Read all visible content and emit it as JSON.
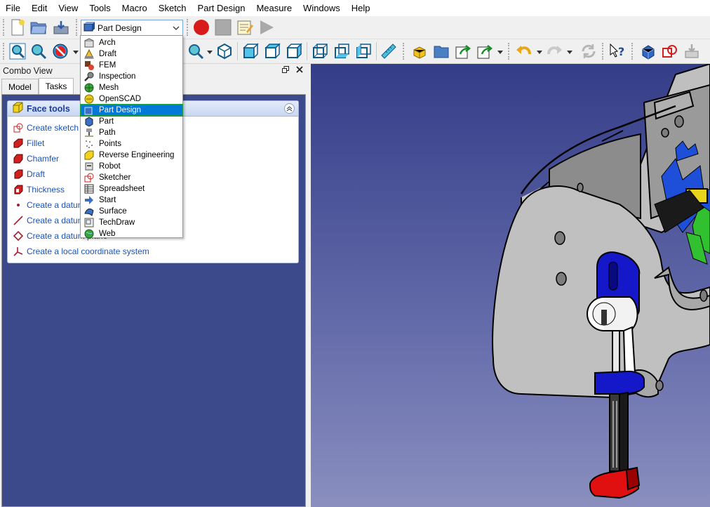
{
  "menubar": {
    "items": [
      "File",
      "Edit",
      "View",
      "Tools",
      "Macro",
      "Sketch",
      "Part Design",
      "Measure",
      "Windows",
      "Help"
    ]
  },
  "workbench_selector": {
    "value": "Part Design",
    "options": [
      {
        "label": "Arch",
        "icon": "arch-icon"
      },
      {
        "label": "Draft",
        "icon": "draft-icon"
      },
      {
        "label": "FEM",
        "icon": "fem-icon"
      },
      {
        "label": "Inspection",
        "icon": "inspection-icon"
      },
      {
        "label": "Mesh",
        "icon": "mesh-icon"
      },
      {
        "label": "OpenSCAD",
        "icon": "openscad-icon"
      },
      {
        "label": "Part Design",
        "icon": "part-design-icon",
        "selected": true
      },
      {
        "label": "Part",
        "icon": "part-icon"
      },
      {
        "label": "Path",
        "icon": "path-icon"
      },
      {
        "label": "Points",
        "icon": "points-icon"
      },
      {
        "label": "Reverse Engineering",
        "icon": "reverse-engineering-icon"
      },
      {
        "label": "Robot",
        "icon": "robot-icon"
      },
      {
        "label": "Sketcher",
        "icon": "sketcher-icon"
      },
      {
        "label": "Spreadsheet",
        "icon": "spreadsheet-icon"
      },
      {
        "label": "Start",
        "icon": "start-icon"
      },
      {
        "label": "Surface",
        "icon": "surface-icon"
      },
      {
        "label": "TechDraw",
        "icon": "techdraw-icon"
      },
      {
        "label": "Web",
        "icon": "web-icon"
      }
    ]
  },
  "combo_view": {
    "title": "Combo View",
    "tabs": [
      "Model",
      "Tasks"
    ],
    "active_tab": "Tasks",
    "panel_title": "Face tools",
    "tools": [
      {
        "label": "Create sketch",
        "icon": "sketch-icon"
      },
      {
        "label": "Fillet",
        "icon": "fillet-icon"
      },
      {
        "label": "Chamfer",
        "icon": "chamfer-icon"
      },
      {
        "label": "Draft",
        "icon": "draft-face-icon"
      },
      {
        "label": "Thickness",
        "icon": "thickness-icon"
      },
      {
        "label": "Create a datum",
        "icon": "datum-point-icon"
      },
      {
        "label": "Create a datum",
        "icon": "datum-line-icon"
      },
      {
        "label": "Create a datum plane",
        "icon": "datum-plane-icon"
      },
      {
        "label": "Create a local coordinate system",
        "icon": "coordinate-system-icon"
      }
    ]
  },
  "colors": {
    "selection": "#0078d7",
    "highlight_outline": "#1a9a3a",
    "task_link": "#1c52b5",
    "viewport_top": "#343d88",
    "viewport_bottom": "#8a8fbf"
  }
}
